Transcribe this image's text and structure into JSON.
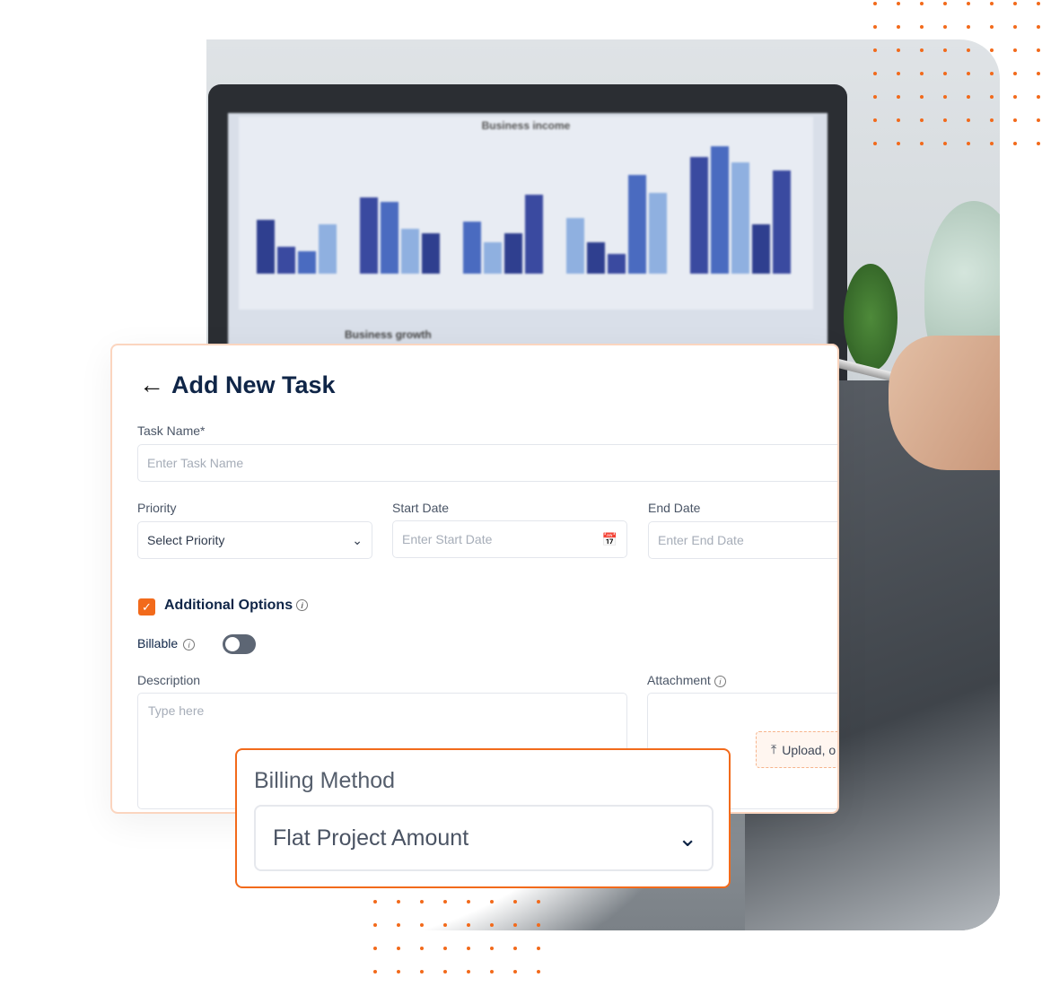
{
  "background_photo": {
    "chart_title": "Business income",
    "chart2_title": "Business growth"
  },
  "form": {
    "title": "Add New Task",
    "task_name": {
      "label": "Task Name*",
      "placeholder": "Enter Task Name"
    },
    "priority": {
      "label": "Priority",
      "value": "Select Priority"
    },
    "start_date": {
      "label": "Start Date",
      "placeholder": "Enter Start Date"
    },
    "end_date": {
      "label": "End Date",
      "placeholder": "Enter End Date"
    },
    "additional_options": {
      "label": "Additional Options",
      "checked": true
    },
    "billable": {
      "label": "Billable",
      "on": false
    },
    "description": {
      "label": "Description",
      "placeholder": "Type here"
    },
    "attachment": {
      "label": "Attachment",
      "upload_label": "Upload, o"
    }
  },
  "billing": {
    "label": "Billing Method",
    "value": "Flat Project Amount"
  },
  "colors": {
    "accent": "#f26a1b",
    "title": "#0f2547"
  }
}
